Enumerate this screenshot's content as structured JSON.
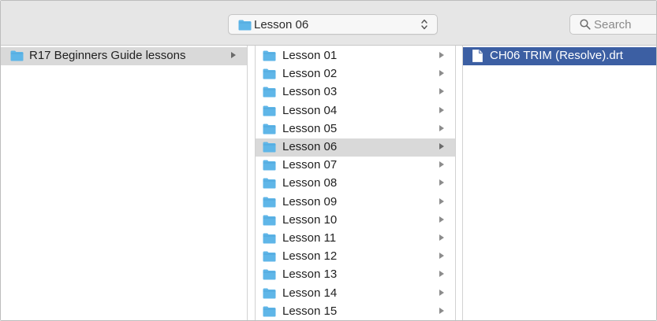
{
  "toolbar": {
    "path_label": "Lesson 06",
    "search_placeholder": "Search"
  },
  "columns": {
    "root": {
      "items": [
        {
          "label": "R17 Beginners Guide lessons",
          "selected": true
        }
      ]
    },
    "lessons": {
      "items": [
        {
          "label": "Lesson 01"
        },
        {
          "label": "Lesson 02"
        },
        {
          "label": "Lesson 03"
        },
        {
          "label": "Lesson 04"
        },
        {
          "label": "Lesson 05"
        },
        {
          "label": "Lesson 06",
          "selected": true
        },
        {
          "label": "Lesson 07"
        },
        {
          "label": "Lesson 08"
        },
        {
          "label": "Lesson 09"
        },
        {
          "label": "Lesson 10"
        },
        {
          "label": "Lesson 11"
        },
        {
          "label": "Lesson 12"
        },
        {
          "label": "Lesson 13"
        },
        {
          "label": "Lesson 14"
        },
        {
          "label": "Lesson 15"
        }
      ]
    },
    "files": {
      "items": [
        {
          "label": "CH06 TRIM (Resolve).drt",
          "selected": true
        }
      ]
    }
  },
  "colors": {
    "folder": "#5fb6e8",
    "selection_active": "#3c5fa3",
    "selection_inactive": "#d9d9d9",
    "toolbar_bg": "#e6e6e6"
  },
  "icons": {
    "folder": "folder-icon",
    "file": "document-icon",
    "search": "search-icon",
    "stepper": "up-down-chevron-icon",
    "disclosure": "disclosure-arrow-icon"
  }
}
